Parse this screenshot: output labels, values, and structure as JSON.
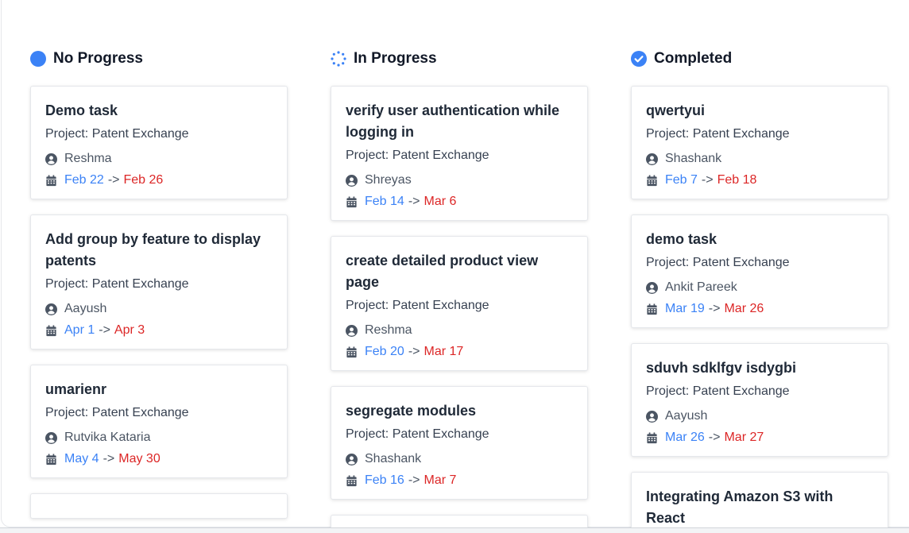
{
  "columns": [
    {
      "title": "No Progress",
      "icon": "filled-circle-icon",
      "color": "#3b82f6",
      "tasks": [
        {
          "title": "Demo task",
          "project": "Project: Patent Exchange",
          "assignee": "Reshma",
          "start": "Feb 22",
          "arrow": "->",
          "end": "Feb 26"
        },
        {
          "title": "Add group by feature to display patents",
          "project": "Project: Patent Exchange",
          "assignee": "Aayush",
          "start": "Apr 1",
          "arrow": "->",
          "end": "Apr 3"
        },
        {
          "title": "umarienr",
          "project": "Project: Patent Exchange",
          "assignee": "Rutvika Kataria",
          "start": "May 4",
          "arrow": "->",
          "end": "May 30"
        },
        {
          "title": "",
          "project": "",
          "assignee": "",
          "start": "",
          "arrow": "",
          "end": ""
        }
      ]
    },
    {
      "title": "In Progress",
      "icon": "spinner-icon",
      "color": "#3b82f6",
      "tasks": [
        {
          "title": "verify user authentication while logging in",
          "project": "Project: Patent Exchange",
          "assignee": "Shreyas",
          "start": "Feb 14",
          "arrow": "->",
          "end": "Mar 6"
        },
        {
          "title": "create detailed product view page",
          "project": "Project: Patent Exchange",
          "assignee": "Reshma",
          "start": "Feb 20",
          "arrow": "->",
          "end": "Mar 17"
        },
        {
          "title": "segregate modules",
          "project": "Project: Patent Exchange",
          "assignee": "Shashank",
          "start": "Feb 16",
          "arrow": "->",
          "end": "Mar 7"
        },
        {
          "title": "",
          "project": "",
          "assignee": "",
          "start": "",
          "arrow": "",
          "end": ""
        }
      ]
    },
    {
      "title": "Completed",
      "icon": "check-circle-icon",
      "color": "#3b82f6",
      "tasks": [
        {
          "title": "qwertyui",
          "project": "Project: Patent Exchange",
          "assignee": "Shashank",
          "start": "Feb 7",
          "arrow": "->",
          "end": "Feb 18"
        },
        {
          "title": "demo task",
          "project": "Project: Patent Exchange",
          "assignee": "Ankit Pareek",
          "start": "Mar 19",
          "arrow": "->",
          "end": "Mar 26"
        },
        {
          "title": "sduvh sdklfgv isdygbi",
          "project": "Project: Patent Exchange",
          "assignee": "Aayush",
          "start": "Mar 26",
          "arrow": "->",
          "end": "Mar 27"
        },
        {
          "title": "Integrating Amazon S3 with React",
          "project": "",
          "assignee": "",
          "start": "",
          "arrow": "",
          "end": ""
        }
      ]
    }
  ],
  "colors": {
    "start_date": "#3b82f6",
    "end_date": "#dc2626",
    "icon_gray": "#4b5563"
  }
}
